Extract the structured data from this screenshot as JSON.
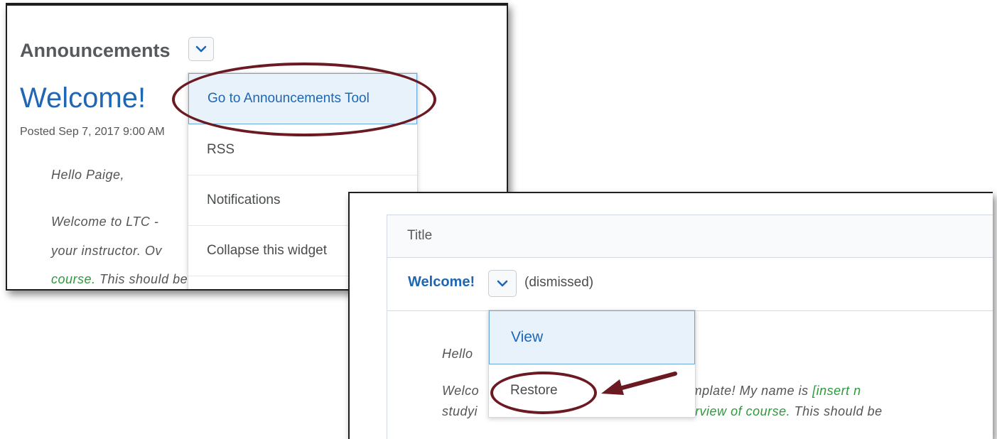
{
  "widget": {
    "heading": "Announcements",
    "item_title": "Welcome!",
    "posted": "Posted Sep 7, 2017 9:00 AM",
    "body": {
      "greeting": "Hello Paige,",
      "line1": "Welcome to LTC - ",
      "line2": "your instructor. Ov",
      "line3_green": "course.",
      "line3_rest": "  This should be a really exciting "
    },
    "menu": [
      {
        "label": "Go to Announcements Tool"
      },
      {
        "label": "RSS"
      },
      {
        "label": "Notifications"
      },
      {
        "label": "Collapse this widget"
      }
    ]
  },
  "table": {
    "header_title": "Title",
    "row": {
      "title": "Welcome!",
      "status": "(dismissed)"
    },
    "body": {
      "greeting": "Hello ",
      "line1_a": "Welco",
      "line1_b": "ourse Template!  My name is ",
      "line1_green": "[insert n",
      "line2_a": "studyi",
      "line2_green": "ce overview of course.",
      "line2_b": "  This should be"
    },
    "menu": [
      {
        "label": "View"
      },
      {
        "label": "Restore"
      }
    ]
  },
  "colors": {
    "link_blue": "#1f66b3",
    "highlight_maroon": "#6b1a22",
    "menu_active_bg": "#e8f2fb",
    "green_text": "#2e9a3c"
  },
  "icons": {
    "dropdown": "chevron-down-icon",
    "callout": "arrow-icon"
  }
}
